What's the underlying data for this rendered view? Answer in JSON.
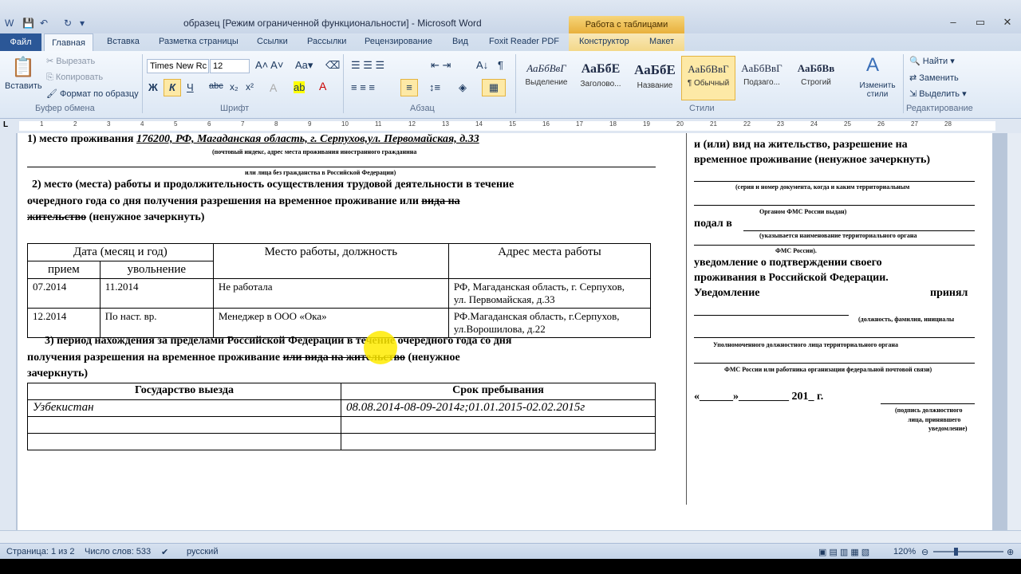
{
  "window": {
    "title": "образец [Режим ограниченной функциональности]  -  Microsoft Word",
    "context_group": "Работа с таблицами"
  },
  "tabs": [
    "Файл",
    "Главная",
    "Вставка",
    "Разметка страницы",
    "Ссылки",
    "Рассылки",
    "Рецензирование",
    "Вид",
    "Foxit Reader PDF",
    "Конструктор",
    "Макет"
  ],
  "ribbon": {
    "clipboard": {
      "paste": "Вставить",
      "cut": "Вырезать",
      "copy": "Копировать",
      "format_painter": "Формат по образцу",
      "label": "Буфер обмена"
    },
    "font": {
      "name": "Times New Rc",
      "size": "12",
      "label": "Шрифт",
      "bold": "Ж",
      "italic": "К",
      "underline": "Ч",
      "strike": "abc",
      "sub": "x₂",
      "sup": "x²"
    },
    "paragraph": {
      "label": "Абзац"
    },
    "styles": {
      "items": [
        {
          "sample": "АаБбВвГ",
          "label": "Выделение"
        },
        {
          "sample": "АаБбЕ",
          "label": "Заголово..."
        },
        {
          "sample": "АаБбЕ",
          "label": "Название"
        },
        {
          "sample": "АаБбВвГ",
          "label": "¶ Обычный"
        },
        {
          "sample": "АаБбВвГ",
          "label": "Подзаго..."
        },
        {
          "sample": "АаБбВв",
          "label": "Строгий"
        }
      ],
      "change": "Изменить стили",
      "label": "Стили"
    },
    "editing": {
      "find": "Найти",
      "replace": "Заменить",
      "select": "Выделить",
      "label": "Редактирование"
    }
  },
  "ruler_numbers": [
    "1",
    "2",
    "3",
    "4",
    "5",
    "6",
    "7",
    "8",
    "9",
    "10",
    "11",
    "12",
    "13",
    "14",
    "15",
    "16",
    "17",
    "18",
    "19",
    "20",
    "21",
    "22",
    "23",
    "24",
    "25",
    "26",
    "27",
    "28"
  ],
  "doc": {
    "l1_label": "1) место проживания",
    "l1_value": "176200, РФ, Магаданская область, г. Серпухов,ул. Первомайская, д.33",
    "l1_sub": "(почтовый индекс, адрес места проживания иностранного гражданина",
    "l1_sub2": "или лица без гражданства в Российской Федерации)",
    "p2_line1": "2) место (места) работы и продолжительность осуществления трудовой деятельности в течение",
    "p2_line2": "очередного  года  со  дня  получения  разрешения  на  временное  проживание  или",
    "p2_line2_strike": "вида  на",
    "p2_line3_strike": "жительство",
    "p2_line3_rest": "(ненужное зачеркнуть)",
    "table1": {
      "h_date": "Дата (месяц и год)",
      "h_place": "Место работы, должность",
      "h_addr": "Адрес места работы",
      "h_start": "прием",
      "h_end": "увольнение",
      "rows": [
        {
          "start": "07.2014",
          "end": "11.2014",
          "place": "Не работала",
          "addr1": "РФ, Магаданская область, г. Серпухов,",
          "addr2": "ул. Первомайская, д.33"
        },
        {
          "start": "12.2014",
          "end": "По наст. вр.",
          "place": "Менеджер в ООО «Ока»",
          "addr1": "РФ.Магаданская  область,  г.Серпухов,",
          "addr2": "ул.Ворошилова, д.22"
        }
      ]
    },
    "p3_line1": "3) период нахождения за пределами Российской Федерации в  течение очередного года со дня",
    "p3_line2": "получения  разрешения  на  временное  проживание",
    "p3_line2_strike": "или  вида  на  жительство",
    "p3_line2_rest": "(ненужное",
    "p3_line3": "зачеркнуть)",
    "table2": {
      "h_country": "Государство выезда",
      "h_term": "Срок пребывания",
      "r1_country": "Узбекистан",
      "r1_term": "08.08.2014-08-09-2014г;01.01.2015-02.02.2015г"
    },
    "right": {
      "r1": "и  (или)  вид  на  жительство,  разрешение  на",
      "r2": "временное проживание (ненужное зачеркнуть)",
      "r3_small": "(серия и номер документа, когда и каким территориальным",
      "r4_small": "Органом ФМС России выдан)",
      "r5": "подал в",
      "r6_small": "(указывается наименование территориального органа",
      "r7_small": "ФМС России).",
      "r8": "уведомление   о   подтверждении   своего",
      "r9": "проживания в Российской Федерации.",
      "r10a": "Уведомление",
      "r10b": "принял",
      "r11_small": "(должность, фамилия, инициалы",
      "r12_small": "Уполномоченного должностного лица территориального органа",
      "r13_small": "ФМС России или работника организации федеральной почтовой связи)",
      "r14": "«______»_________ 201_ г.",
      "r15_small": "(подпись должностного",
      "r16_small": "лица,  принявшего",
      "r17_small": "уведомление)"
    }
  },
  "status": {
    "page": "Страница: 1 из 2",
    "words": "Число слов: 533",
    "lang": "русский",
    "zoom": "120%"
  }
}
